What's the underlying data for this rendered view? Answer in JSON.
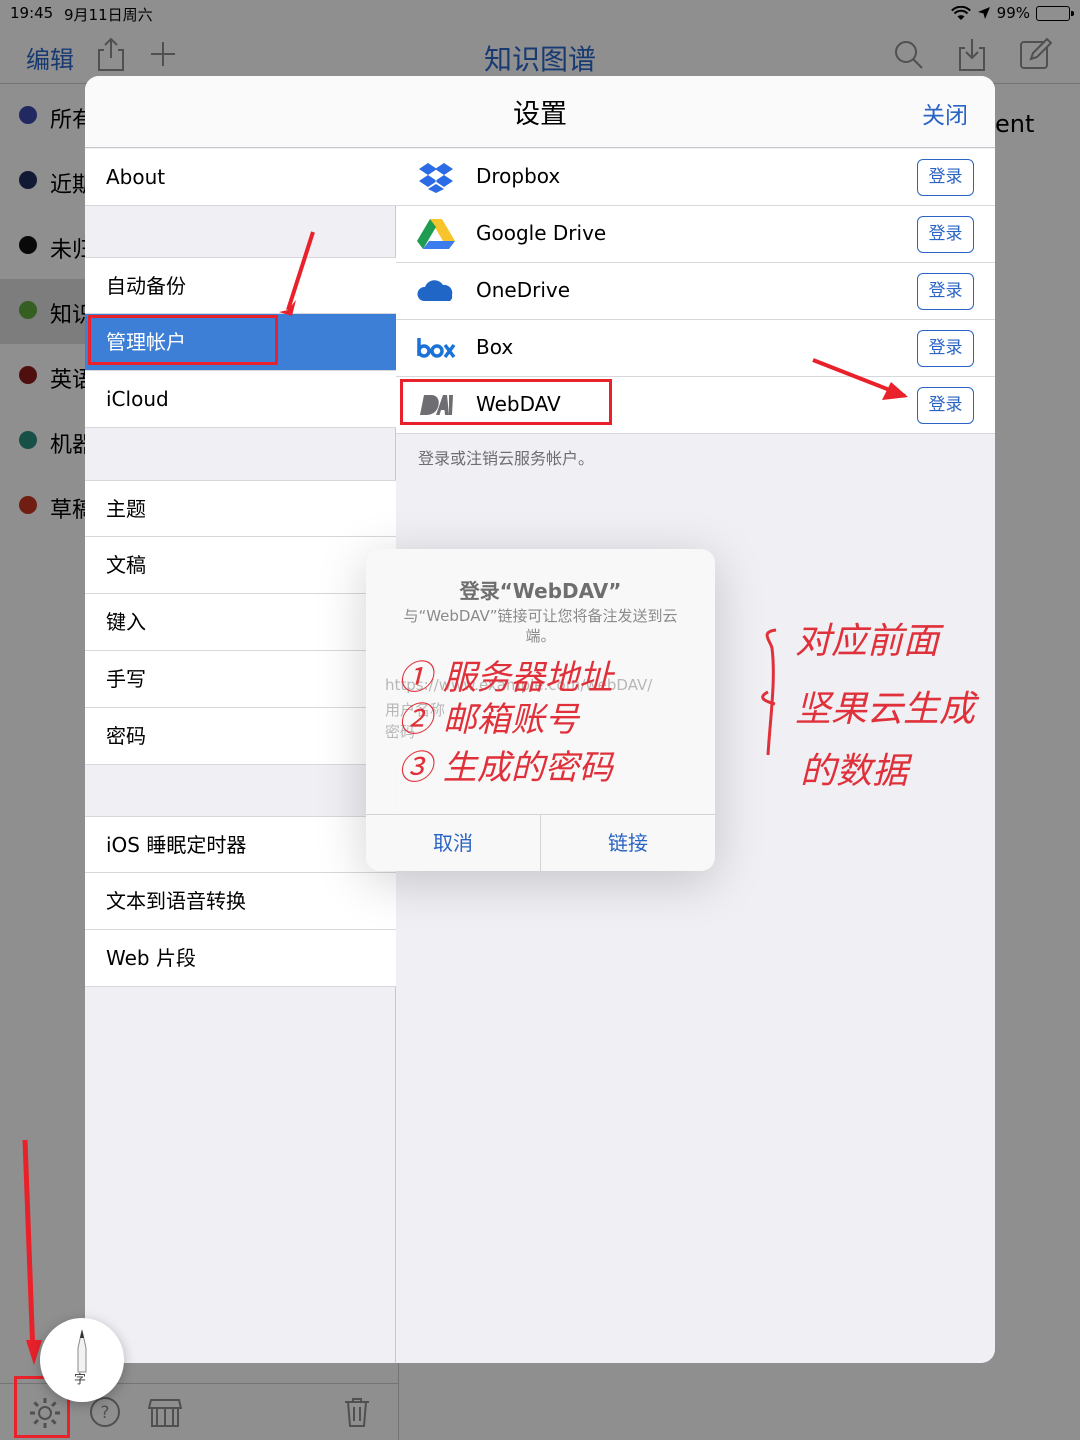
{
  "status_bar": {
    "time": "19:45",
    "date": "9月11日周六",
    "battery": "99%"
  },
  "nav": {
    "edit_label": "编辑",
    "title": "知识图谱"
  },
  "sidebar": {
    "items": [
      {
        "label": "所有",
        "color": "#3b47a8"
      },
      {
        "label": "近期",
        "color": "#1f2c5c"
      },
      {
        "label": "未归",
        "color": "#111111"
      },
      {
        "label": "知识",
        "color": "#5aa23c"
      },
      {
        "label": "英语",
        "color": "#8b1a1a"
      },
      {
        "label": "机器",
        "color": "#2a8a7a"
      },
      {
        "label": "草稿",
        "color": "#c2331f"
      }
    ]
  },
  "right_snippet": "ent",
  "settings": {
    "title": "设置",
    "close_label": "关闭",
    "menu": {
      "about": "About",
      "auto_backup": "自动备份",
      "manage_accounts": "管理帐户",
      "icloud": "iCloud",
      "theme": "主题",
      "docs": "文稿",
      "typing": "键入",
      "handwriting": "手写",
      "password": "密码",
      "sleep_timer": "iOS 睡眠定时器",
      "tts": "文本到语音转换",
      "web_clip": "Web 片段"
    },
    "accounts": [
      {
        "name": "Dropbox",
        "button": "登录",
        "icon": "dropbox-icon"
      },
      {
        "name": "Google Drive",
        "button": "登录",
        "icon": "google-drive-icon"
      },
      {
        "name": "OneDrive",
        "button": "登录",
        "icon": "onedrive-icon"
      },
      {
        "name": "Box",
        "button": "登录",
        "icon": "box-icon"
      },
      {
        "name": "WebDAV",
        "button": "登录",
        "icon": "webdav-icon"
      }
    ],
    "footnote": "登录或注销云服务帐户。"
  },
  "alert": {
    "title": "登录“WebDAV”",
    "message": "与“WebDAV”链接可让您将备注发送到云端。",
    "url_placeholder": "https://www.example.com/webDAV/",
    "user_placeholder": "用户名称",
    "password_placeholder": "密码",
    "cancel": "取消",
    "connect": "链接"
  },
  "annotations": {
    "note_lines_left": [
      "① 服务器地址",
      "② 邮箱账号",
      "③ 生成的密码"
    ],
    "note_lines_right": [
      "对应前面",
      "坚果云生成",
      "的数据"
    ]
  },
  "pencil_label": "字",
  "colors": {
    "accent": "#2a64c5",
    "selected": "#3d7fd7",
    "annotation": "#e8212b"
  }
}
